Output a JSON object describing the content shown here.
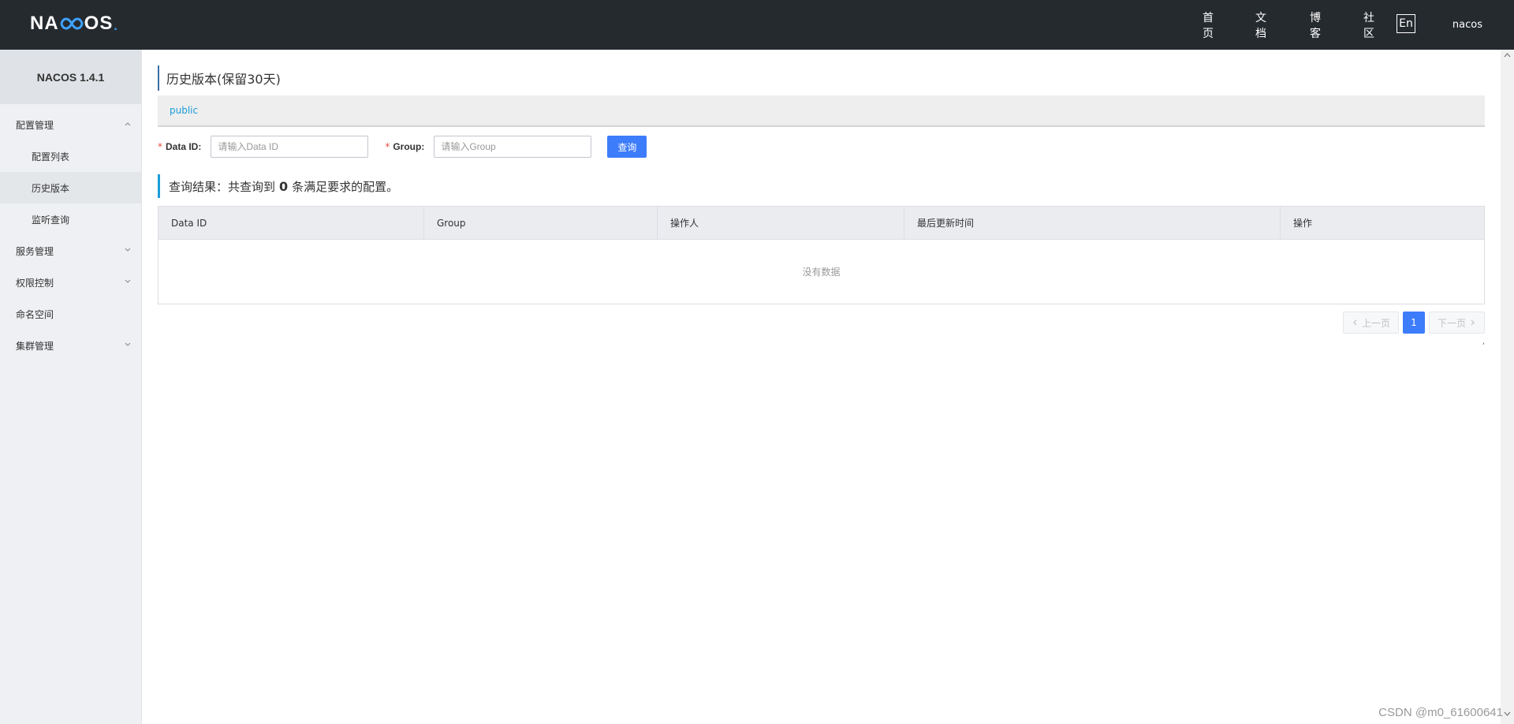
{
  "header": {
    "logo_text_left": "NA",
    "logo_text_right": "OS",
    "logo_dot": ".",
    "nav": {
      "home": "首页",
      "docs": "文档",
      "blog": "博客",
      "community": "社区",
      "lang": "En",
      "user": "nacos"
    }
  },
  "sidebar": {
    "title": "NACOS 1.4.1",
    "config_mgmt": "配置管理",
    "config_list": "配置列表",
    "history": "历史版本",
    "listener_query": "监听查询",
    "service_mgmt": "服务管理",
    "auth_control": "权限控制",
    "namespace": "命名空间",
    "cluster_mgmt": "集群管理"
  },
  "main": {
    "title": "历史版本(保留30天)",
    "namespace": "public",
    "form": {
      "required_mark": "*",
      "data_id_label": "Data ID:",
      "data_id_placeholder": "请输入Data ID",
      "data_id_value": "",
      "group_label": "Group:",
      "group_placeholder": "请输入Group",
      "group_value": "",
      "query_button": "查询"
    },
    "result": {
      "prefix": "查询结果：共查询到",
      "count": "0",
      "suffix": "条满足要求的配置。"
    },
    "table": {
      "columns": [
        "Data ID",
        "Group",
        "操作人",
        "最后更新时间",
        "操作"
      ],
      "rows": [],
      "empty_text": "没有数据"
    },
    "pagination": {
      "prev": "上一页",
      "current": "1",
      "next": "下一页"
    },
    "stray_mark": ","
  },
  "watermark": "CSDN @m0_61600641",
  "colors": {
    "topbar": "#252a2f",
    "primary": "#3d7cfa",
    "link": "#1a9cd8"
  }
}
